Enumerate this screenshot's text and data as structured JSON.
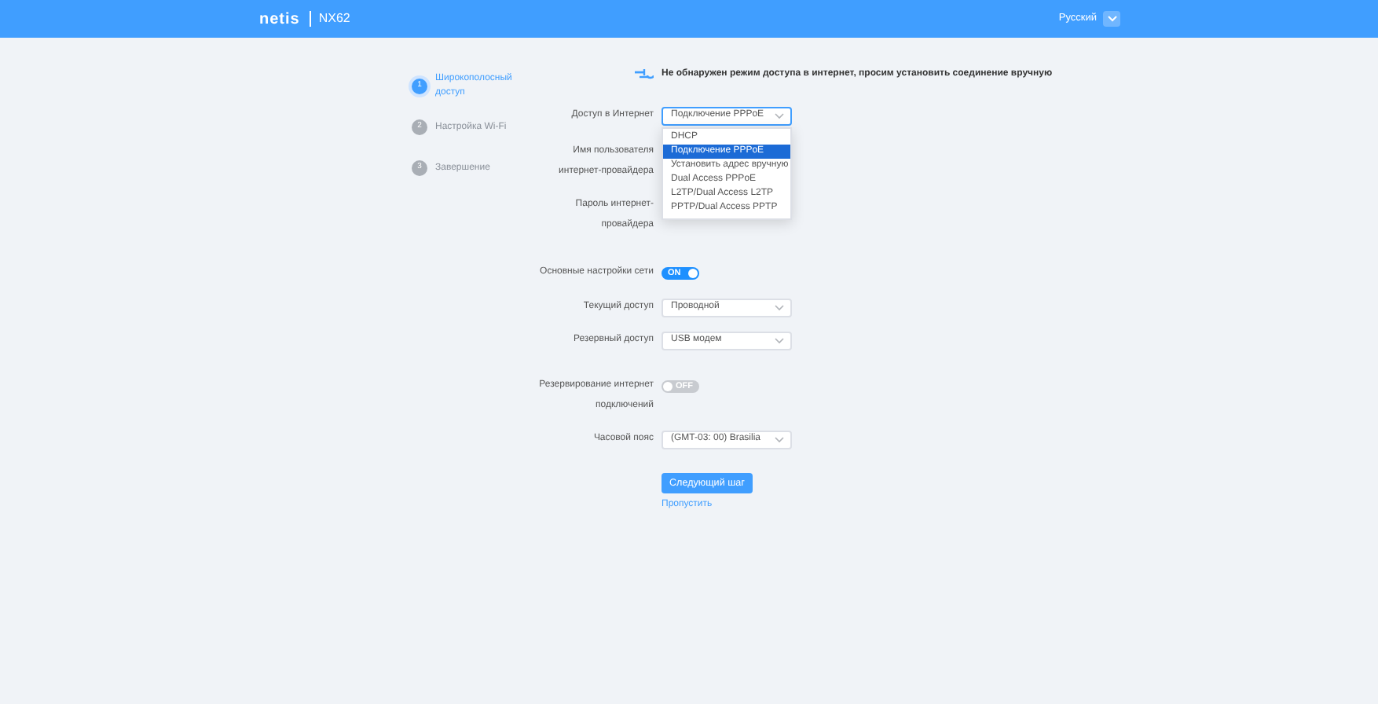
{
  "header": {
    "logo": "netis",
    "model": "NX62",
    "language": "Русский"
  },
  "steps": [
    {
      "number": "1",
      "label": "Широкополосный доступ",
      "selected": true
    },
    {
      "number": "2",
      "label": "Настройка Wi-Fi",
      "selected": false
    },
    {
      "number": "3",
      "label": "Завершение",
      "selected": false
    }
  ],
  "notice": "Не обнаружен режим доступа в интернет, просим установить соединение вручную",
  "access": {
    "label": "Доступ в Интернет",
    "value": "Подключение PPPoE",
    "expanded": true,
    "options": [
      {
        "label": "DHCP",
        "selected": false
      },
      {
        "label": "Подключение PPPoE",
        "selected": true
      },
      {
        "label": "Установить адрес вручную",
        "selected": false
      },
      {
        "label": "Dual Access PPPoE",
        "selected": false
      },
      {
        "label": "L2TP/Dual Access L2TP",
        "selected": false
      },
      {
        "label": "PPTP/Dual Access PPTP",
        "selected": false
      }
    ]
  },
  "username": {
    "label": "Имя пользователя интернет-провайдера"
  },
  "password": {
    "label": "Пароль интернет-провайдера"
  },
  "settings": [
    {
      "kind": "toggle",
      "label": "Основные настройки сети",
      "on": true,
      "text": "ON"
    },
    {
      "kind": "select",
      "label": "Текущий доступ",
      "value": "Проводной"
    },
    {
      "kind": "select",
      "label": "Резервный доступ",
      "value": "USB модем"
    },
    {
      "kind": "toggle",
      "label": "Резервирование интернет подключений",
      "on": false,
      "text": "OFF"
    },
    {
      "kind": "select",
      "label": "Часовой пояс",
      "value": "(GMT-03: 00) Brasilia"
    }
  ],
  "next_button": "Следующий шаг",
  "skip_link": "Пропустить"
}
